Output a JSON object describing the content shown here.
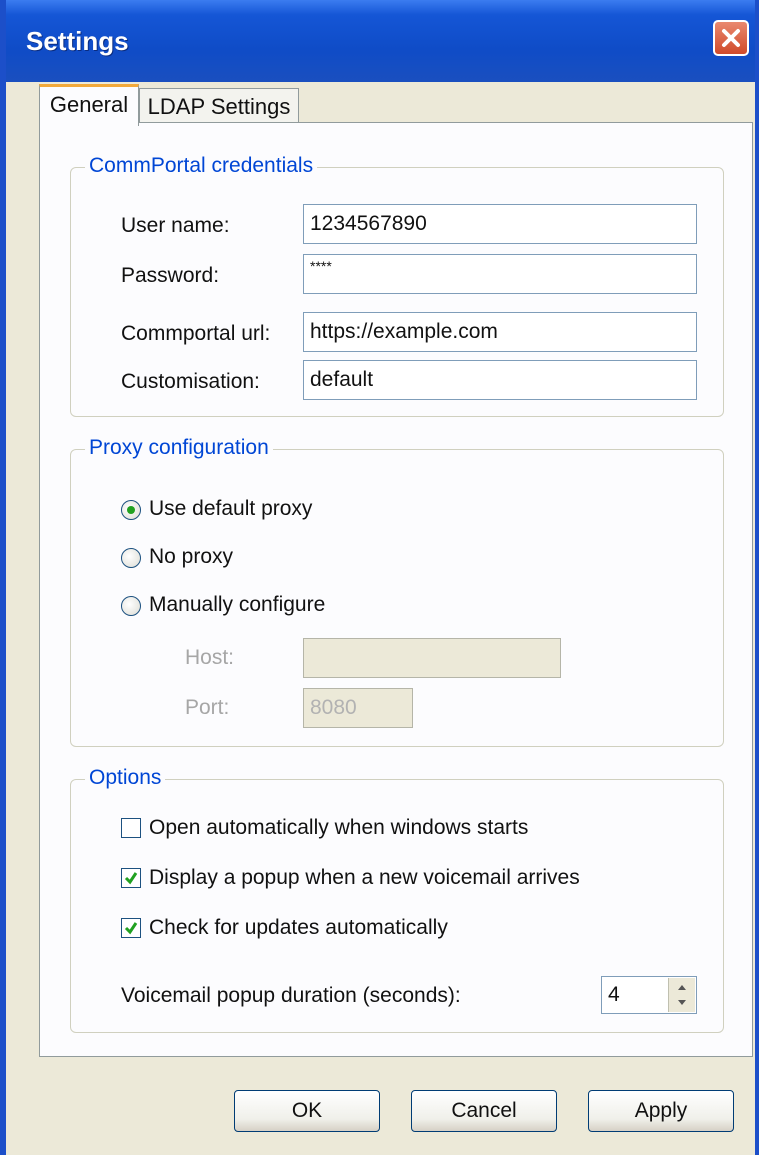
{
  "window": {
    "title": "Settings"
  },
  "tabs": [
    {
      "label": "General",
      "active": true
    },
    {
      "label": "LDAP Settings",
      "active": false
    }
  ],
  "credentials": {
    "legend": "CommPortal credentials",
    "user_name_label": "User name:",
    "user_name_value": "1234567890",
    "password_label": "Password:",
    "password_value": "****",
    "url_label": "Commportal url:",
    "url_value": "https://example.com",
    "customisation_label": "Customisation:",
    "customisation_value": "default"
  },
  "proxy": {
    "legend": "Proxy configuration",
    "options": [
      {
        "label": "Use default proxy",
        "selected": true
      },
      {
        "label": "No proxy",
        "selected": false
      },
      {
        "label": "Manually configure",
        "selected": false
      }
    ],
    "host_label": "Host:",
    "host_value": "",
    "port_label": "Port:",
    "port_value": "8080"
  },
  "options": {
    "legend": "Options",
    "checkboxes": [
      {
        "label": "Open automatically when windows starts",
        "checked": false
      },
      {
        "label": "Display a popup when a new voicemail arrives",
        "checked": true
      },
      {
        "label": "Check for updates automatically",
        "checked": true
      }
    ],
    "duration_label": "Voicemail popup duration (seconds):",
    "duration_value": "4"
  },
  "buttons": {
    "ok": "OK",
    "cancel": "Cancel",
    "apply": "Apply"
  },
  "colors": {
    "titlebar": "#0f4cc7",
    "group_legend": "#0046d5",
    "window_bg": "#ece9d8",
    "tab_highlight": "#f2a93b"
  }
}
